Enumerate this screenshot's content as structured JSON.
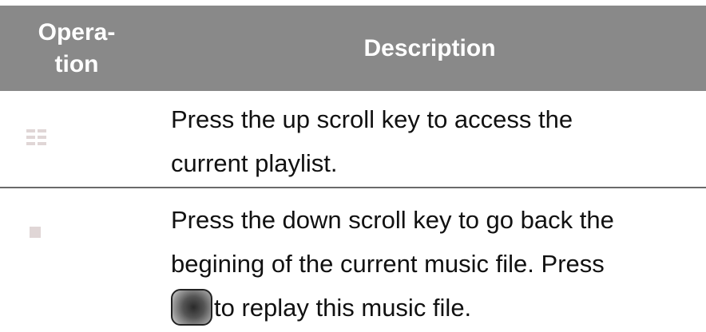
{
  "header": {
    "operation_line1": "Opera-",
    "operation_line2": "tion",
    "description": "Description"
  },
  "rows": [
    {
      "icon": "up-scroll-key-icon",
      "lines": [
        "Press the up scroll key to access the",
        "current playlist."
      ]
    },
    {
      "icon": "down-scroll-key-icon",
      "lines": [
        "Press the down scroll key to go back the",
        "begining of the current music file. Press"
      ],
      "last_line_icon": "play-key-icon",
      "last_line_text": "to replay this music file."
    }
  ],
  "colors": {
    "header_bg": "#898989",
    "header_text": "#ffffff",
    "divider": "#6a6a6a",
    "icon_tint": "#e0d6d6"
  }
}
